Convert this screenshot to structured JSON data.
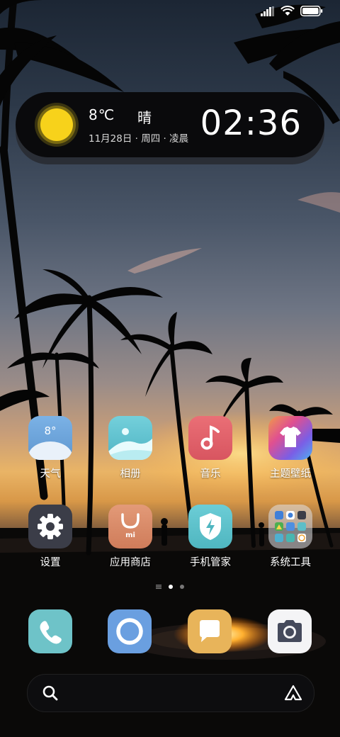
{
  "status_bar": {
    "icons": [
      "signal-icon",
      "wifi-icon",
      "battery-icon"
    ]
  },
  "widget": {
    "temperature": "8℃",
    "condition": "晴",
    "date": "11月28日 · 周四 · 凌晨",
    "time": "02:36",
    "icon": "sun-icon"
  },
  "apps": [
    {
      "label": "天气",
      "icon": "weather-icon",
      "badge": "8°",
      "color": "#6ea7dc"
    },
    {
      "label": "相册",
      "icon": "gallery-icon",
      "color": "#5fc0d0"
    },
    {
      "label": "音乐",
      "icon": "music-icon",
      "color": "#e0626b"
    },
    {
      "label": "主题壁纸",
      "icon": "theme-icon",
      "color": "#a86ae0"
    },
    {
      "label": "设置",
      "icon": "settings-icon",
      "color": "#3d3f4a"
    },
    {
      "label": "应用商店",
      "icon": "app-store-icon",
      "icon_text": "mi",
      "color": "#d88a66"
    },
    {
      "label": "手机管家",
      "icon": "security-icon",
      "color": "#5dbec8"
    },
    {
      "label": "系统工具",
      "icon": "folder-icon",
      "color": "#dcdce0"
    }
  ],
  "dock": [
    {
      "name": "phone",
      "icon": "phone-icon",
      "color": "#6ec3c8"
    },
    {
      "name": "browser",
      "icon": "browser-icon",
      "color": "#6a9fe0"
    },
    {
      "name": "messages",
      "icon": "messages-icon",
      "color": "#e8b45a"
    },
    {
      "name": "camera",
      "icon": "camera-icon",
      "color": "#f4f4f6"
    }
  ],
  "page_indicator": {
    "pages": 2,
    "active": 1
  },
  "search_bar": {
    "left_icon": "search-icon",
    "right_icon": "assistant-icon"
  }
}
